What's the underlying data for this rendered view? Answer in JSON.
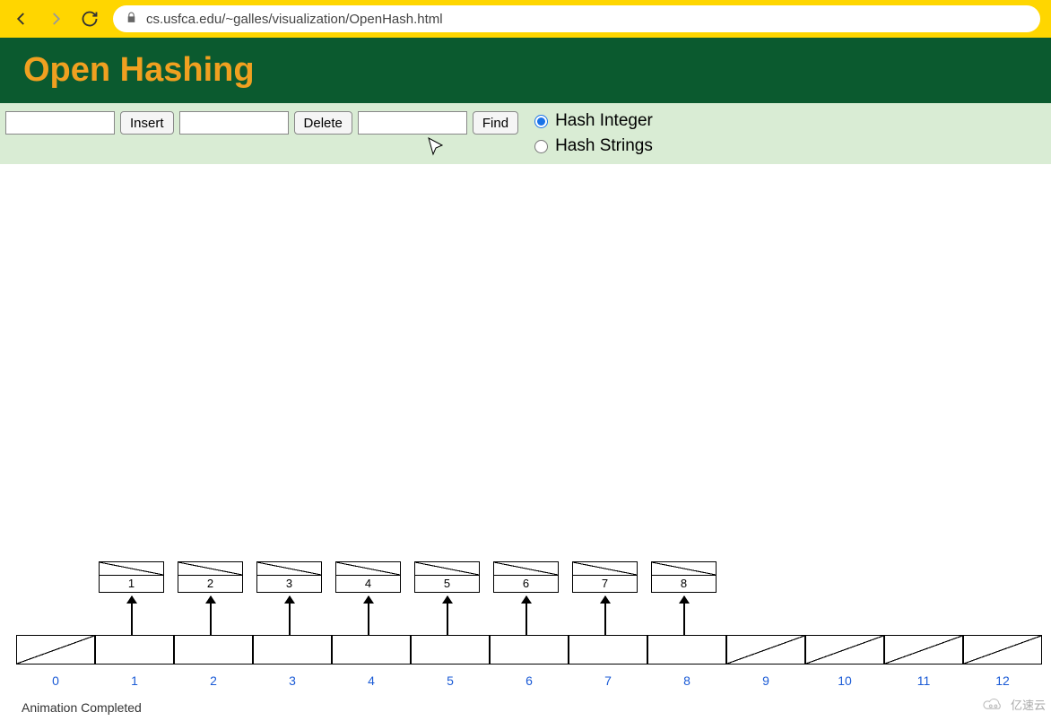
{
  "browser": {
    "url": "cs.usfca.edu/~galles/visualization/OpenHash.html"
  },
  "header": {
    "title": "Open Hashing"
  },
  "controls": {
    "insert_input": "",
    "insert_label": "Insert",
    "delete_input": "",
    "delete_label": "Delete",
    "find_input": "",
    "find_label": "Find",
    "radio_integer": "Hash Integer",
    "radio_strings": "Hash Strings"
  },
  "chart_data": {
    "type": "table",
    "description": "Open hash table visualization",
    "table_size": 13,
    "indices": [
      "0",
      "1",
      "2",
      "3",
      "4",
      "5",
      "6",
      "7",
      "8",
      "9",
      "10",
      "11",
      "12"
    ],
    "slots": [
      {
        "index": 0,
        "empty": true,
        "chain": []
      },
      {
        "index": 1,
        "empty": false,
        "chain": [
          "1"
        ]
      },
      {
        "index": 2,
        "empty": false,
        "chain": [
          "2"
        ]
      },
      {
        "index": 3,
        "empty": false,
        "chain": [
          "3"
        ]
      },
      {
        "index": 4,
        "empty": false,
        "chain": [
          "4"
        ]
      },
      {
        "index": 5,
        "empty": false,
        "chain": [
          "5"
        ]
      },
      {
        "index": 6,
        "empty": false,
        "chain": [
          "6"
        ]
      },
      {
        "index": 7,
        "empty": false,
        "chain": [
          "7"
        ]
      },
      {
        "index": 8,
        "empty": false,
        "chain": [
          "8"
        ]
      },
      {
        "index": 9,
        "empty": true,
        "chain": []
      },
      {
        "index": 10,
        "empty": true,
        "chain": []
      },
      {
        "index": 11,
        "empty": true,
        "chain": []
      },
      {
        "index": 12,
        "empty": true,
        "chain": []
      }
    ]
  },
  "status": "Animation Completed",
  "watermark": "亿速云"
}
